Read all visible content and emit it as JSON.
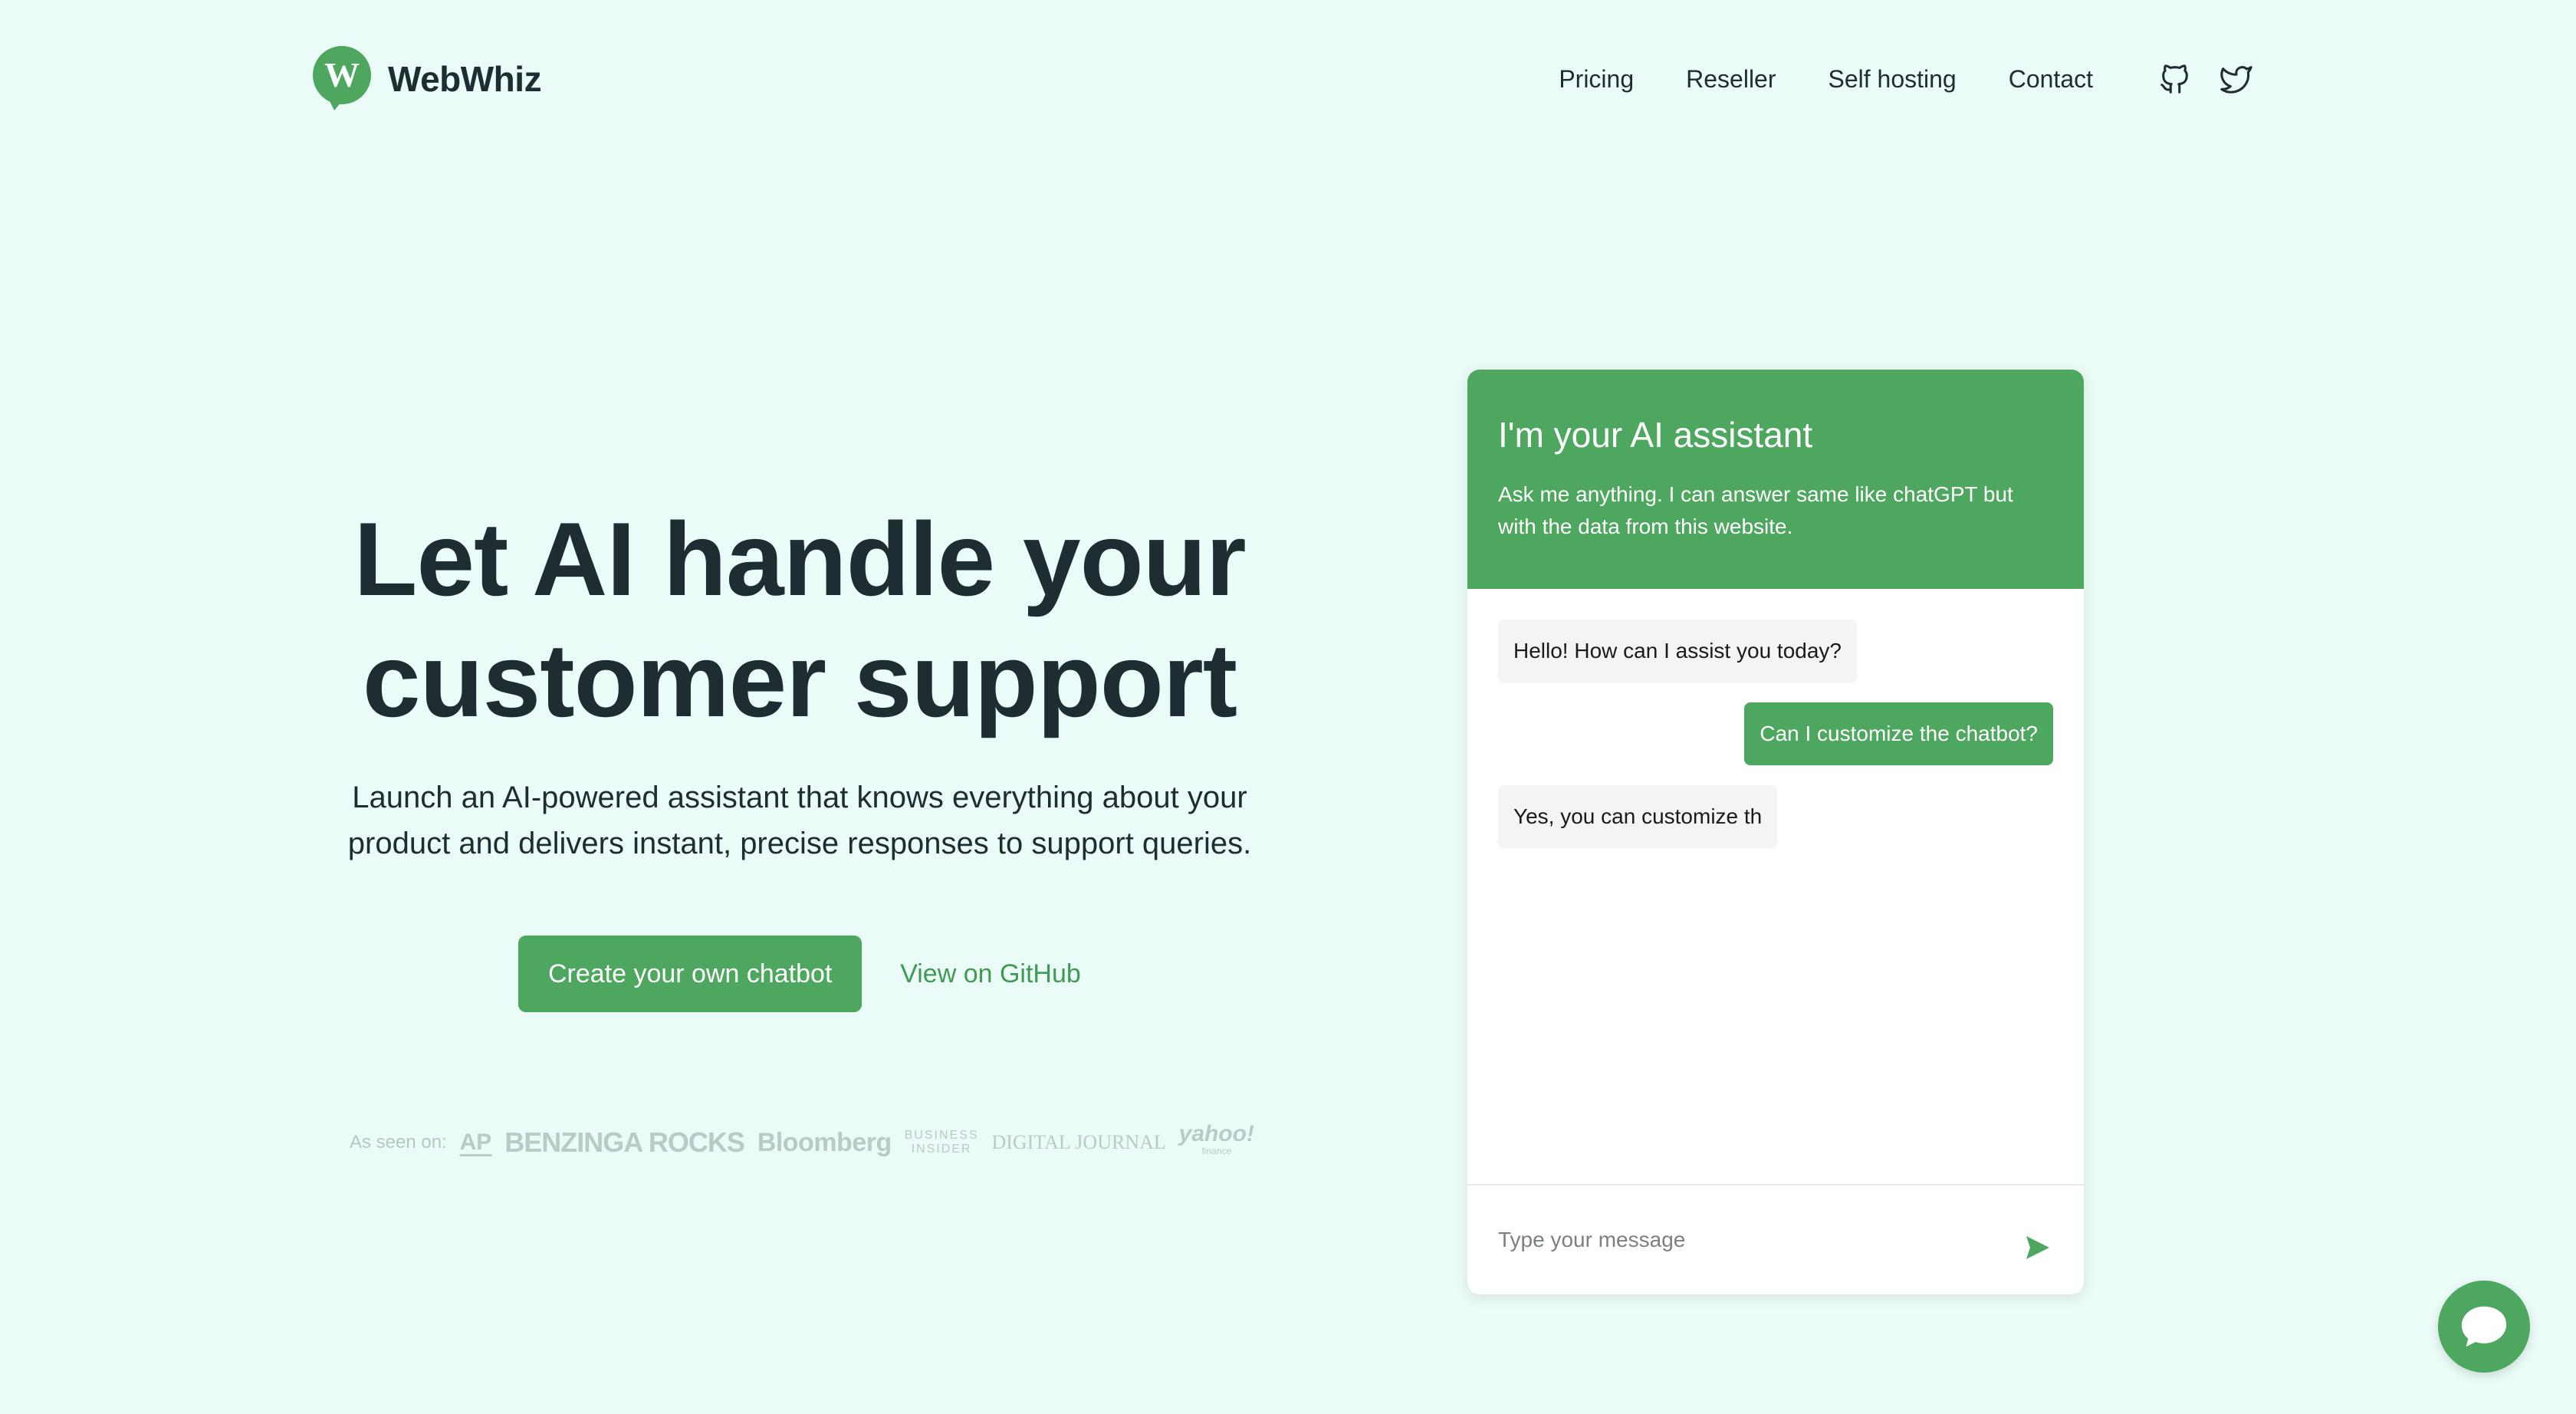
{
  "brand": {
    "name": "WebWhiz",
    "logo_letter": "W"
  },
  "nav": {
    "links": [
      "Pricing",
      "Reseller",
      "Self hosting",
      "Contact"
    ],
    "icons": [
      "github-icon",
      "twitter-icon"
    ]
  },
  "hero": {
    "title_line1": "Let AI handle your",
    "title_line2": "customer support",
    "subtitle": "Launch an AI-powered assistant that knows everything about your product and delivers instant, precise responses to support queries.",
    "primary_cta": "Create your own chatbot",
    "secondary_cta": "View on GitHub"
  },
  "press": {
    "label": "As seen on:",
    "logos": [
      "AP",
      "BENZINGA ROCKS",
      "Bloomberg",
      "BUSINESS",
      "INSIDER",
      "DIGITAL JOURNAL",
      "yahoo!",
      "finance"
    ]
  },
  "chat": {
    "title": "I'm your AI assistant",
    "description": "Ask me anything. I can answer same like chatGPT but with the data from this website.",
    "messages": [
      {
        "role": "bot",
        "text": "Hello! How can I assist you today?"
      },
      {
        "role": "user",
        "text": "Can I customize the chatbot?"
      },
      {
        "role": "bot",
        "text": "Yes, you can customize th"
      }
    ],
    "input_placeholder": "Type your message"
  },
  "colors": {
    "background": "#ebfcf8",
    "accent": "#4ea75f",
    "text": "#1f2d33",
    "muted": "#b3c7c4"
  }
}
